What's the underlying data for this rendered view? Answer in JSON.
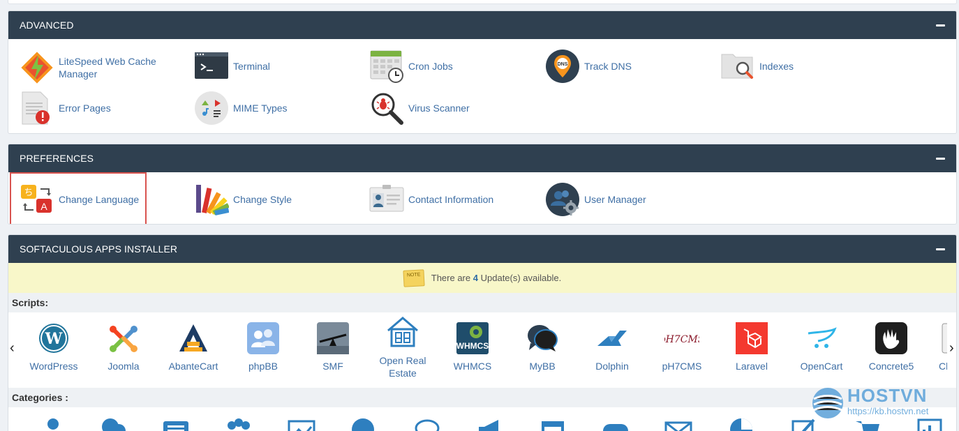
{
  "advanced": {
    "title": "ADVANCED",
    "items": [
      {
        "label": "LiteSpeed Web Cache Manager",
        "icon": "litespeed-icon"
      },
      {
        "label": "Terminal",
        "icon": "terminal-icon"
      },
      {
        "label": "Cron Jobs",
        "icon": "calendar-clock-icon"
      },
      {
        "label": "Track DNS",
        "icon": "dns-pin-icon"
      },
      {
        "label": "Indexes",
        "icon": "folder-search-icon"
      },
      {
        "label": "Error Pages",
        "icon": "error-page-icon"
      },
      {
        "label": "MIME Types",
        "icon": "mime-media-icon"
      },
      {
        "label": "Virus Scanner",
        "icon": "bug-magnifier-icon"
      }
    ]
  },
  "preferences": {
    "title": "PREFERENCES",
    "items": [
      {
        "label": "Change Language",
        "icon": "translate-icon"
      },
      {
        "label": "Change Style",
        "icon": "color-swatch-icon"
      },
      {
        "label": "Contact Information",
        "icon": "contact-card-icon"
      },
      {
        "label": "User Manager",
        "icon": "users-gear-icon"
      }
    ]
  },
  "softaculous": {
    "title": "SOFTACULOUS APPS INSTALLER",
    "update_prefix": "There are",
    "update_count": "4",
    "update_suffix": "Update(s) available.",
    "note_label": "NOTE",
    "scripts_label": "Scripts:",
    "categories_label": "Categories :",
    "scripts": [
      "WordPress",
      "Joomla",
      "AbanteCart",
      "phpBB",
      "SMF",
      "Open Real Estate",
      "WHMCS",
      "MyBB",
      "Dolphin",
      "pH7CMS",
      "Laravel",
      "OpenCart",
      "Concrete5",
      "Cl"
    ]
  },
  "watermark": {
    "brand": "HOSTVN",
    "url": "https://kb.hostvn.net"
  },
  "colors": {
    "header_bg": "#2f4050",
    "link": "#3f6fa5",
    "highlight": "#d9534f",
    "update_bar": "#f8f7c9"
  }
}
